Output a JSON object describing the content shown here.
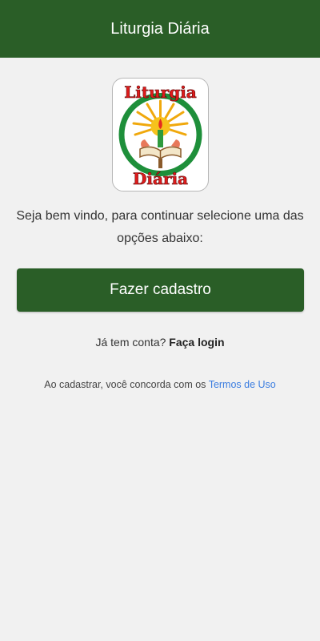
{
  "app_bar": {
    "title": "Liturgia Diária"
  },
  "logo": {
    "text_top": "Liturgia",
    "text_bottom": "Diária"
  },
  "welcome": {
    "message": "Seja bem vindo, para continuar selecione uma das opções abaixo:"
  },
  "actions": {
    "signup_label": "Fazer cadastro",
    "login_prompt": "Já tem conta?",
    "login_link": "Faça login"
  },
  "terms": {
    "text": "Ao cadastrar, você concorda com os",
    "link": "Termos de Uso"
  },
  "colors": {
    "primary": "#2a5e27",
    "background": "#f1f1f1",
    "link": "#3b7de0"
  }
}
